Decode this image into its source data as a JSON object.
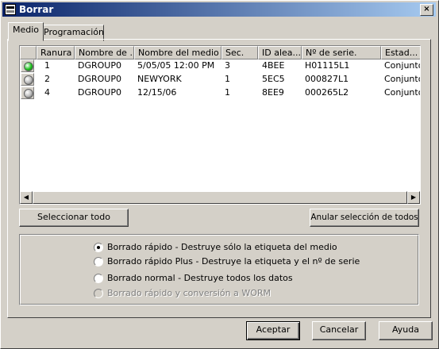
{
  "window": {
    "title": "Borrar",
    "close_glyph": "×",
    "icon": "app-icon"
  },
  "tabs": [
    {
      "label": "Medio",
      "active": true
    },
    {
      "label": "Programación",
      "active": false
    }
  ],
  "list": {
    "columns": [
      "Ranura",
      "Nombre de ...",
      "Nombre del medio",
      "Sec.",
      "ID alea...",
      "Nº de serie.",
      "Estad..."
    ],
    "rows": [
      {
        "status": "green",
        "slot": "1",
        "group": "DGROUP0",
        "media": "5/05/05 12:00 PM",
        "sec": "3",
        "id": "4BEE",
        "serial": "H01115L1",
        "state": "Conjunto"
      },
      {
        "status": "gray",
        "slot": "2",
        "group": "DGROUP0",
        "media": "NEWYORK",
        "sec": "1",
        "id": "5EC5",
        "serial": "000827L1",
        "state": "Conjunto"
      },
      {
        "status": "gray",
        "slot": "4",
        "group": "DGROUP0",
        "media": "12/15/06",
        "sec": "1",
        "id": "8EE9",
        "serial": "000265L2",
        "state": "Conjunto"
      }
    ],
    "status_colors": {
      "green": "#18c018",
      "gray": "#b8b8b8"
    }
  },
  "buttons": {
    "select_all": "Seleccionar todo",
    "deselect_all": "Anular selección de todos",
    "accept": "Aceptar",
    "cancel": "Cancelar",
    "help": "Ayuda"
  },
  "options": [
    {
      "label": "Borrado rápido - Destruye sólo la etiqueta del medio",
      "selected": true,
      "enabled": true
    },
    {
      "label": "Borrado rápido Plus - Destruye la etiqueta y el nº de serie",
      "selected": false,
      "enabled": true
    },
    {
      "label": "Borrado normal - Destruye todos los datos",
      "selected": false,
      "enabled": true
    },
    {
      "label": "Borrado rápido y conversión a WORM",
      "selected": false,
      "enabled": false
    }
  ]
}
